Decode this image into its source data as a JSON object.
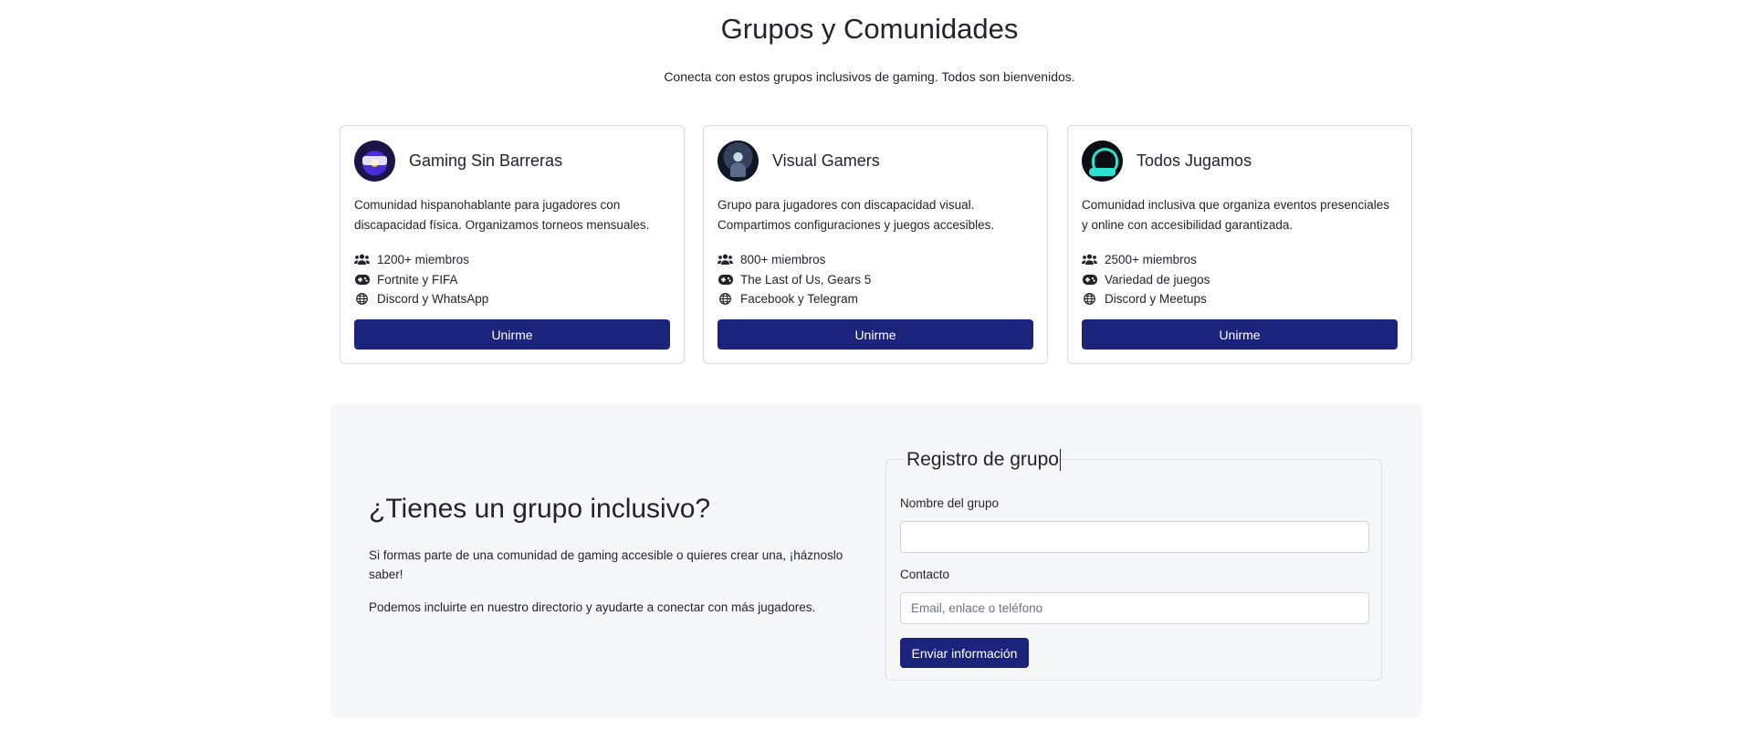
{
  "header": {
    "title": "Grupos y Comunidades",
    "subtitle": "Conecta con estos grupos inclusivos de gaming. Todos son bienvenidos."
  },
  "groups": [
    {
      "name": "Gaming Sin Barreras",
      "description": "Comunidad hispanohablante para jugadores con discapacidad física. Organizamos torneos mensuales.",
      "members": "1200+ miembros",
      "games": "Fortnite y FIFA",
      "platforms": "Discord y WhatsApp",
      "button": "Unirme"
    },
    {
      "name": "Visual Gamers",
      "description": "Grupo para jugadores con discapacidad visual. Compartimos configuraciones y juegos accesibles.",
      "members": "800+ miembros",
      "games": "The Last of Us, Gears 5",
      "platforms": "Facebook y Telegram",
      "button": "Unirme"
    },
    {
      "name": "Todos Jugamos",
      "description": "Comunidad inclusiva que organiza eventos presenciales y online con accesibilidad garantizada.",
      "members": "2500+ miembros",
      "games": "Variedad de juegos",
      "platforms": "Discord y Meetups",
      "button": "Unirme"
    }
  ],
  "signup": {
    "title": "¿Tienes un grupo inclusivo?",
    "paragraph1": "Si formas parte de una comunidad de gaming accesible o quieres crear una, ¡háznoslo saber!",
    "paragraph2": "Podemos incluirte en nuestro directorio y ayudarte a conectar con más jugadores.",
    "form": {
      "legend": "Registro de grupo",
      "name_label": "Nombre del grupo",
      "name_value": "",
      "contact_label": "Contacto",
      "contact_placeholder": "Email, enlace o teléfono",
      "submit": "Enviar información"
    }
  },
  "icons": {
    "members": "users-icon",
    "games": "gamepad-icon",
    "platforms": "globe-icon"
  },
  "colors": {
    "primary_button": "#1b237b",
    "signup_background": "#f6f7f9"
  }
}
